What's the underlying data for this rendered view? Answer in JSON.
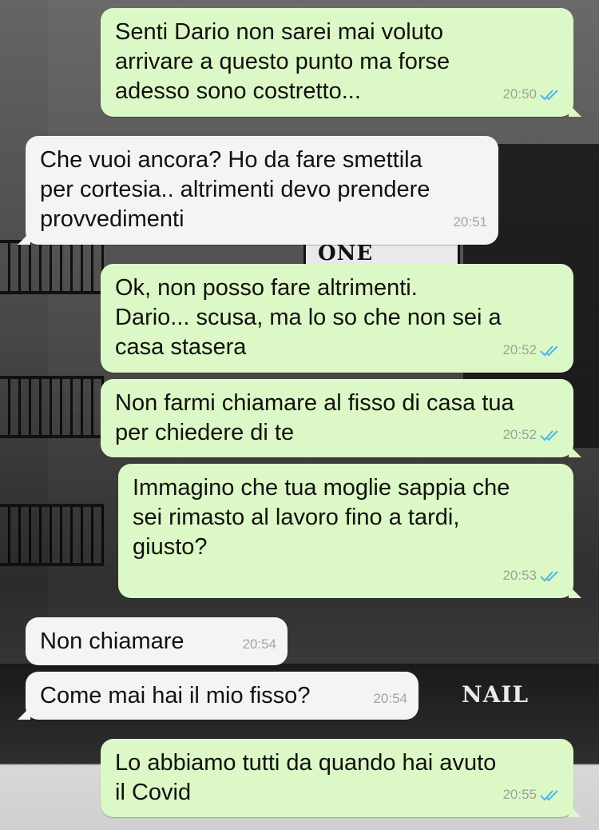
{
  "wallpaper": {
    "signs": [
      "ONE",
      "NAIL"
    ],
    "colors": {
      "outgoing_bubble": "#dcf8c6",
      "incoming_bubble": "#f4f4f4",
      "read_tick": "#4fb6ec"
    }
  },
  "messages": [
    {
      "direction": "out",
      "text": "Senti Dario non sarei mai voluto\narrivare a questo punto ma forse\nadesso sono costretto...",
      "time": "20:50",
      "status": "read-ticks-icon"
    },
    {
      "direction": "in",
      "text": "Che vuoi ancora? Ho da fare smettila\nper cortesia.. altrimenti devo prendere\nprovvedimenti",
      "time": "20:51"
    },
    {
      "direction": "out",
      "text": "Ok, non posso fare altrimenti.\nDario... scusa, ma lo so che non sei a\ncasa stasera",
      "time": "20:52",
      "status": "read-ticks-icon"
    },
    {
      "direction": "out",
      "text": "Non farmi chiamare al fisso di casa tua\nper chiedere di te",
      "time": "20:52",
      "status": "read-ticks-icon"
    },
    {
      "direction": "out",
      "text": "Immagino che tua moglie sappia che\nsei rimasto al lavoro fino a tardi,\ngiusto?",
      "time": "20:53",
      "status": "read-ticks-icon"
    },
    {
      "direction": "in",
      "text": "Non chiamare",
      "time": "20:54"
    },
    {
      "direction": "in",
      "text": "Come mai hai il mio fisso?",
      "time": "20:54"
    },
    {
      "direction": "out",
      "text": "Lo abbiamo tutti da quando hai avuto\nil Covid",
      "time": "20:55",
      "status": "read-ticks-icon"
    }
  ]
}
